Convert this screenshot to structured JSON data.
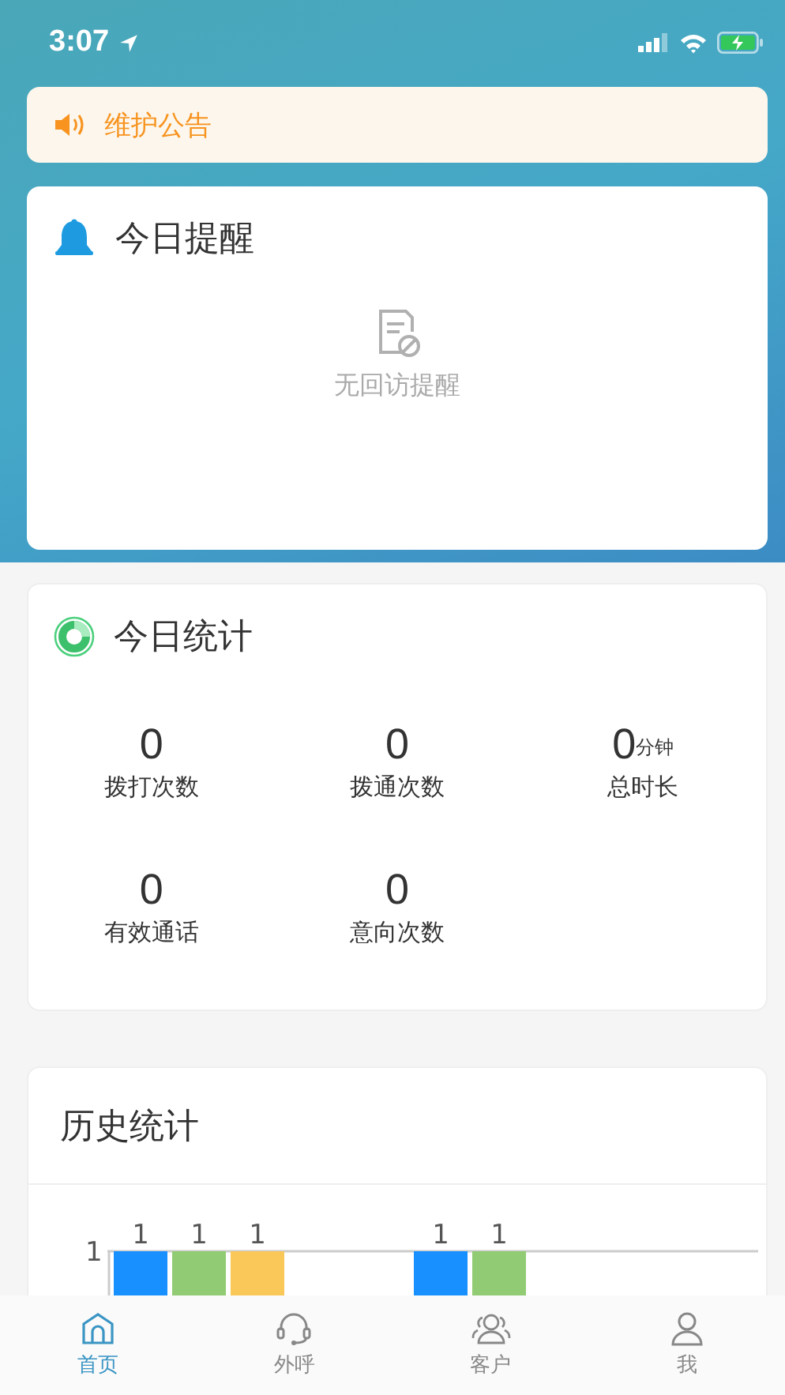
{
  "status_bar": {
    "time": "3:07"
  },
  "notice": {
    "text": "维护公告"
  },
  "reminders": {
    "title": "今日提醒",
    "empty_text": "无回访提醒"
  },
  "today_stats": {
    "title": "今日统计",
    "items": [
      {
        "value": "0",
        "label": "拨打次数"
      },
      {
        "value": "0",
        "label": "拨通次数"
      },
      {
        "value": "0",
        "unit": "分钟",
        "label": "总时长"
      },
      {
        "value": "0",
        "label": "有效通话"
      },
      {
        "value": "0",
        "label": "意向次数"
      }
    ]
  },
  "history": {
    "title": "历史统计",
    "axis_label": "1",
    "bar_groups": [
      {
        "bars": [
          {
            "label": "1",
            "color": "#1890ff"
          },
          {
            "label": "1",
            "color": "#91cb74"
          },
          {
            "label": "1",
            "color": "#fac858"
          }
        ]
      },
      {
        "bars": [
          {
            "label": "1",
            "color": "#1890ff"
          },
          {
            "label": "1",
            "color": "#91cb74"
          }
        ]
      }
    ]
  },
  "tab_bar": {
    "items": [
      {
        "label": "首页",
        "selected": true
      },
      {
        "label": "外呼",
        "selected": false
      },
      {
        "label": "客户",
        "selected": false
      },
      {
        "label": "我",
        "selected": false
      }
    ]
  }
}
